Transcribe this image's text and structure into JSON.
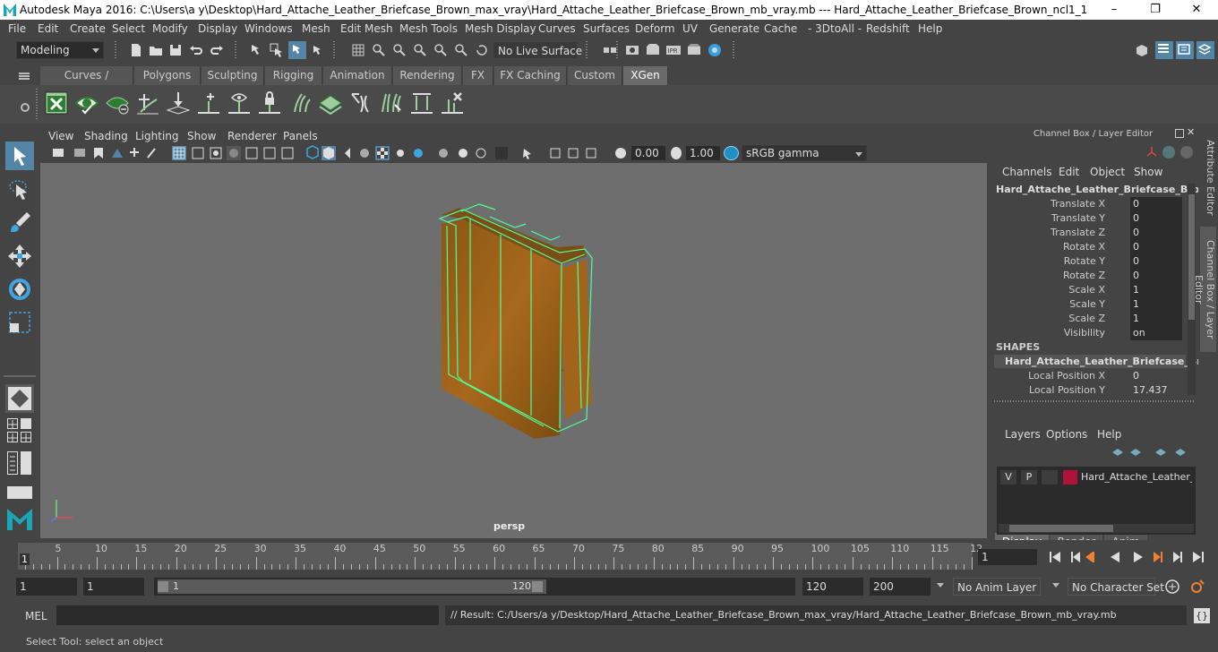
{
  "window": {
    "title": "Autodesk Maya 2016: C:\\Users\\a y\\Desktop\\Hard_Attache_Leather_Briefcase_Brown_max_vray\\Hard_Attache_Leather_Briefcase_Brown_mb_vray.mb  ---  Hard_Attache_Leather_Briefcase_Brown_ncl1_1",
    "minimize": "–",
    "maximize": "❐",
    "close": "✕"
  },
  "menubar": [
    "File",
    "Edit",
    "Create",
    "Select",
    "Modify",
    "Display",
    "Windows",
    "Mesh",
    "Edit Mesh",
    "Mesh Tools",
    "Mesh Display",
    "Curves",
    "Surfaces",
    "Deform",
    "UV",
    "Generate",
    "Cache",
    "- 3DtoAll -",
    "Redshift",
    "Help"
  ],
  "statusline": {
    "mode": "Modeling",
    "live_surface": "No Live Surface"
  },
  "shelf_tabs": [
    "Curves / Surfaces",
    "Polygons",
    "Sculpting",
    "Rigging",
    "Animation",
    "Rendering",
    "FX",
    "FX Caching",
    "Custom",
    "XGen"
  ],
  "active_shelf_tab": "XGen",
  "viewport": {
    "menu": [
      "View",
      "Shading",
      "Lighting",
      "Show",
      "Renderer",
      "Panels"
    ],
    "exposure": "0.00",
    "gamma": "1.00",
    "color_space": "sRGB gamma",
    "camera_label": "persp"
  },
  "channel_box": {
    "header": "Channel Box / Layer Editor",
    "menu": [
      "Channels",
      "Edit",
      "Object",
      "Show"
    ],
    "object_name": "Hard_Attache_Leather_Briefcase_Brow...",
    "attributes": [
      {
        "name": "Translate X",
        "value": "0"
      },
      {
        "name": "Translate Y",
        "value": "0"
      },
      {
        "name": "Translate Z",
        "value": "0"
      },
      {
        "name": "Rotate X",
        "value": "0"
      },
      {
        "name": "Rotate Y",
        "value": "0"
      },
      {
        "name": "Rotate Z",
        "value": "0"
      },
      {
        "name": "Scale X",
        "value": "1"
      },
      {
        "name": "Scale Y",
        "value": "1"
      },
      {
        "name": "Scale Z",
        "value": "1"
      },
      {
        "name": "Visibility",
        "value": "on"
      }
    ],
    "shapes_label": "SHAPES",
    "shape_name": "Hard_Attache_Leather_Briefcase_Bro...",
    "shape_attributes": [
      {
        "name": "Local Position X",
        "value": "0"
      },
      {
        "name": "Local Position Y",
        "value": "17.437"
      }
    ]
  },
  "side_tabs": [
    "Attribute Editor",
    "Channel Box / Layer Editor"
  ],
  "layer_editor": {
    "tabs": [
      "Display",
      "Render",
      "Anim"
    ],
    "active_tab": "Display",
    "menu": [
      "Layers",
      "Options",
      "Help"
    ],
    "layer": {
      "v": "V",
      "p": "P",
      "name": "Hard_Attache_Leather_Bi",
      "color": "#b0123a"
    }
  },
  "timeline": {
    "labels": [
      "5",
      "10",
      "15",
      "20",
      "25",
      "30",
      "35",
      "40",
      "45",
      "50",
      "55",
      "60",
      "65",
      "70",
      "75",
      "80",
      "85",
      "90",
      "95",
      "100",
      "105",
      "110",
      "115",
      "12"
    ],
    "current_frame_marker": "1",
    "current_frame": "1"
  },
  "range": {
    "start": "1",
    "playback_start": "1",
    "slider_start": "1",
    "slider_end": "120",
    "playback_end": "120",
    "end": "200",
    "anim_layer": "No Anim Layer",
    "character_set": "No Character Set"
  },
  "command": {
    "label": "MEL",
    "result": "// Result: C:/Users/a y/Desktop/Hard_Attache_Leather_Briefcase_Brown_max_vray/Hard_Attache_Leather_Briefcase_Brown_mb_vray.mb"
  },
  "help_line": "Select Tool: select an object",
  "colors": {
    "accent": "#5285a6",
    "wireframe": "#4dff9a",
    "leather": "#9a6018"
  }
}
